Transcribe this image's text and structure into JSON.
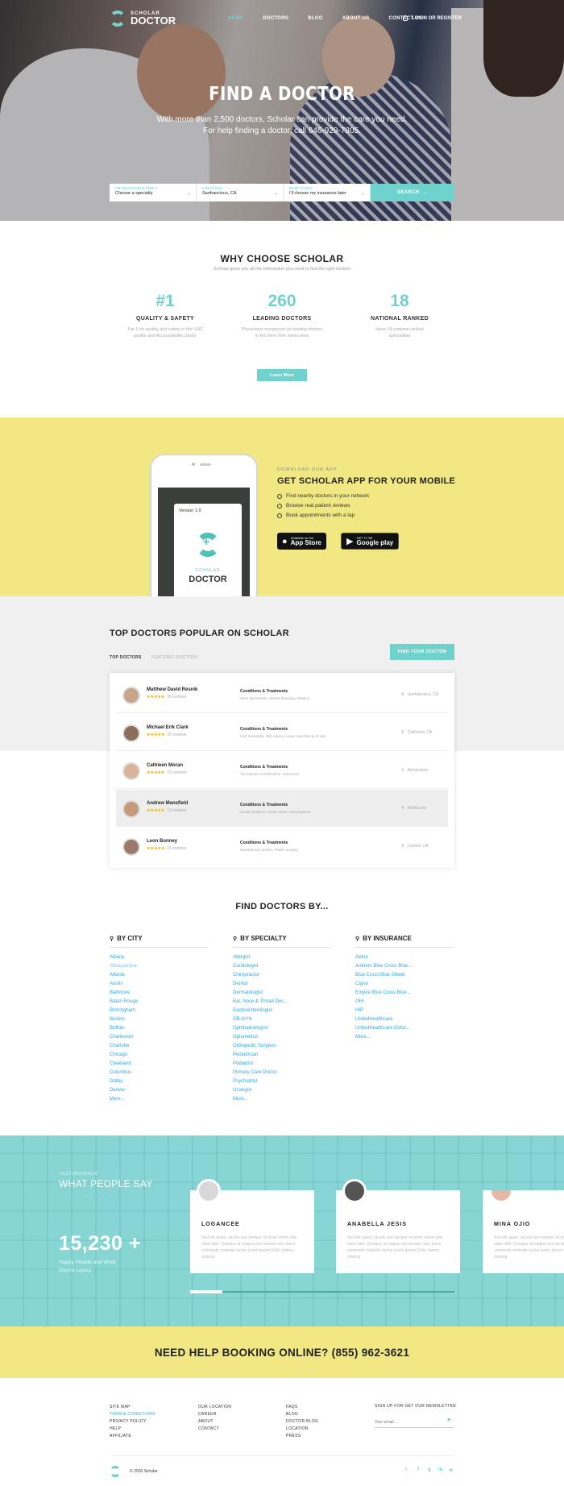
{
  "header": {
    "logo_small": "SCHOLAR",
    "logo_big": "DOCTOR",
    "nav": [
      "HOME",
      "DOCTORS",
      "BLOG",
      "ABOUT US",
      "CONTACT US"
    ],
    "login": "LOGIN OR REGISTER"
  },
  "hero": {
    "title": "FIND A DOCTOR",
    "subtitle1": "With more than 2,500 doctors, Scholar can provide the care you need.",
    "subtitle2": "For help finding a doctor, call 646-929-7805."
  },
  "search": {
    "f1_label": "I'M SEARCHING FOR A",
    "f1_value": "Choose a specialty",
    "f2_label": "LOCATION",
    "f2_value": "Sanfrancisco, CA",
    "f3_label": "WHO TAKES",
    "f3_value": "I'll choose my insurance later",
    "button": "SEARCH"
  },
  "why": {
    "title": "WHY CHOOSE SCHOLAR",
    "subtitle": "Scholar gives you all the information you need to find the right doctors",
    "stats": [
      {
        "num": "#1",
        "title": "QUALITY & SAFETY",
        "d1": "Top 1 for quality and safety in the UHC",
        "d2": "quality and Accountability Study."
      },
      {
        "num": "260",
        "title": "LEADING DOCTORS",
        "d1": "Physicians recognized as leading doctors",
        "d2": "in the New York metro area"
      },
      {
        "num": "18",
        "title": "NATIONAL RANKED",
        "d1": "Have 18 national ranked",
        "d2": "specialities"
      }
    ],
    "button": "Learn More"
  },
  "app": {
    "kicker": "DOWNLOAD OUR APP",
    "title": "GET SCHOLAR APP FOR YOUR MOBILE",
    "features": [
      "Find nearby doctors in your network",
      "Browse real patient reviews",
      "Book appointments with a tap"
    ],
    "phone_version": "Version 1.0",
    "phone_logo_small": "SCHOLAR",
    "phone_logo_big": "DOCTOR",
    "appstore_small": "Available on the",
    "appstore_big": "App Store",
    "gplay_small": "GET IT ON",
    "gplay_big": "Google play"
  },
  "top": {
    "title": "TOP DOCTORS POPULAR ON SCHOLAR",
    "tabs": [
      "TOP DOCTORS",
      "FEATURED DOCTORS"
    ],
    "button": "FIND YOUR DOCTOR",
    "doctors": [
      {
        "name": "Matthew David Resnik",
        "stars": "★★★★★",
        "reviews": "35 reviews",
        "ct": "Conditions & Treatments",
        "cd": "Stent placement, Uterine bleeding, Ablation",
        "loc": "Sanfrancisco, CA"
      },
      {
        "name": "Michael Erik Clark",
        "stars": "★★★★★",
        "reviews": "28 reviews",
        "ct": "Conditions & Treatments",
        "cd": "Hair transplant, Skin cancer, Laser resurfacing of skin",
        "loc": "California, CA"
      },
      {
        "name": "Cathleen Moran",
        "stars": "★★★★★",
        "reviews": "23 reviews",
        "ct": "Conditions & Treatments",
        "cd": "Therapeutic embolization, Varicocele",
        "loc": "Amsterdam"
      },
      {
        "name": "Andrew Mansfield",
        "stars": "★★★★★",
        "reviews": "19 reviews",
        "ct": "Conditions & Treatments",
        "cd": "Facial paralysis, Eyelid repair, Hemangioma",
        "loc": "Melbourne"
      },
      {
        "name": "Leon Bonney",
        "stars": "★★★★★",
        "reviews": "15 reviews",
        "ct": "Conditions & Treatments",
        "cd": "Maxillofacial injuries, Plastic surgery",
        "loc": "London, UK"
      }
    ]
  },
  "findby": {
    "title": "FIND DOCTORS BY...",
    "city_h": "BY CITY",
    "specialty_h": "BY SPECIALTY",
    "insurance_h": "BY INSURANCE",
    "city": [
      "Albany",
      "Albuquerque",
      "Atlanta",
      "Austin",
      "Baltimore",
      "Baton Rouge",
      "Birmingham",
      "Boston",
      "Buffalo",
      "Charleston",
      "Charlotte",
      "Chicago",
      "Cleveland",
      "Columbus",
      "Dallas",
      "Denver",
      "More..."
    ],
    "specialty": [
      "Allergist",
      "Cardiologist",
      "Chiropractor",
      "Dentist",
      "Dermatologist",
      "Ear, Nose & Throat Doc...",
      "Gastroenterologist",
      "OB-GYN",
      "Ophthalmologist",
      "Optometrist",
      "Orthopedic Surgeon",
      "Pediatrician",
      "Podiatrist",
      "Primary Care Doctor",
      "Psychiatrist",
      "Urologist",
      "More..."
    ],
    "insurance": [
      "Aetna",
      "Anthem Blue Cross Blue...",
      "Blue Cross Blue Shield",
      "Cigna",
      "Empire Blue Cross Blue...",
      "GHI",
      "HIP",
      "UnitedHealthcare",
      "UnitedHealthcare Oxfor...",
      "More..."
    ]
  },
  "testimonials": {
    "kicker": "TESTIMONIALS",
    "title": "WHAT PEOPLE SAY",
    "count": "15,230 +",
    "count_d1": "Happy People and What",
    "count_d2": "they're saying",
    "text": "Sed elit quam, iaculis sed semper sit amet solicit udin vitae nibh. Quisque at magna sed semper avit, fusce commodo molestie luctus lorem ipsum Dolor lusima dolamp",
    "cards": [
      "LOGANCEE",
      "ANABELLA JESIS",
      "MINA OJIO"
    ]
  },
  "help": {
    "text": "NEED HELP BOOKING ONLINE? (855) 962-3621"
  },
  "footer": {
    "col1": [
      "SITE MAP",
      "TERM & CONDITIONS",
      "PRIVACY POLICY",
      "HELP",
      "AFFILIATE"
    ],
    "col2": [
      "OUR LOCATION",
      "CAREER",
      "ABOUT",
      "CONTACT"
    ],
    "col3": [
      "FAQS",
      "BLOG",
      "DOCTOR BLOG",
      "LOCATION",
      "PRESS"
    ],
    "newsletter": "SIGN UP FOR GET OUR NEWSLETTER",
    "email_ph": "Your email...",
    "copyright": "© 2016 Scholar"
  }
}
